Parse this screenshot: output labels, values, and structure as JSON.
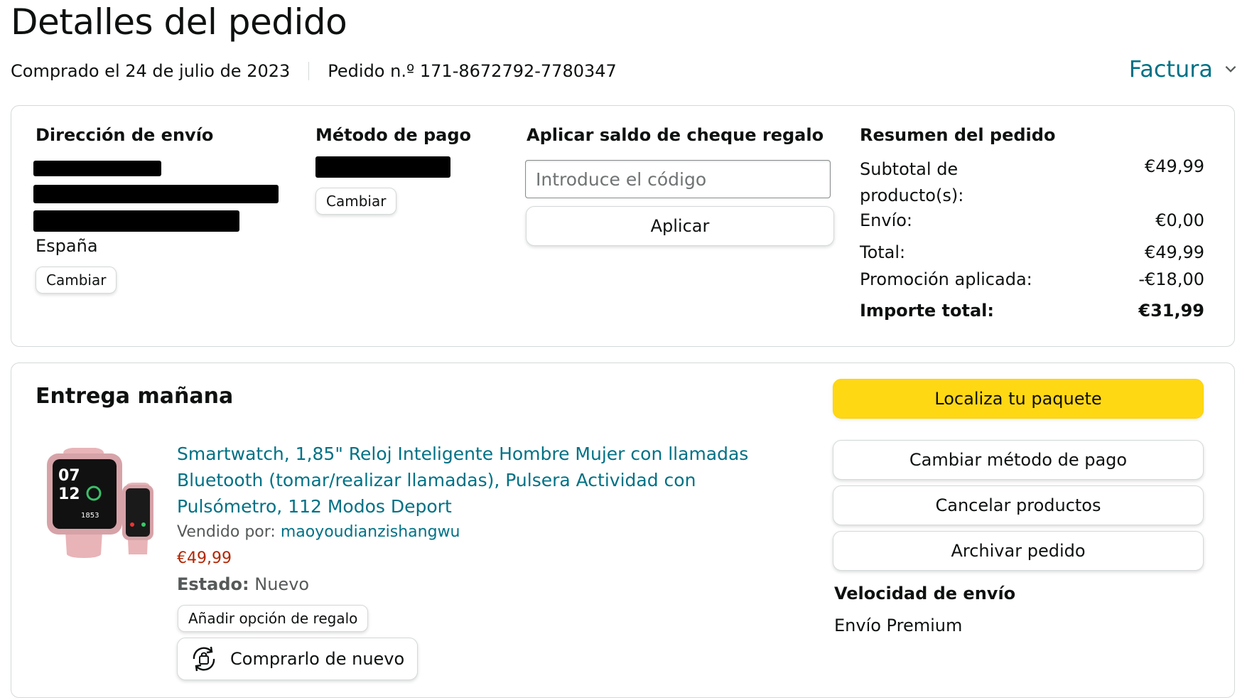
{
  "page_title": "Detalles del pedido",
  "order_meta": {
    "purchase_date": "Comprado el 24 de julio de 2023",
    "order_number": "Pedido n.º 171-8672792-7780347",
    "invoice_label": "Factura"
  },
  "shipping": {
    "heading": "Dirección de envío",
    "country": "España",
    "change_label": "Cambiar"
  },
  "payment": {
    "heading": "Método de pago",
    "change_label": "Cambiar"
  },
  "gift_card": {
    "heading": "Aplicar saldo de cheque regalo",
    "placeholder": "Introduce el código",
    "apply_label": "Aplicar"
  },
  "summary": {
    "heading": "Resumen del pedido",
    "rows": [
      {
        "label": "Subtotal de producto(s):",
        "value": "€49,99"
      },
      {
        "label": "Envío:",
        "value": "€0,00"
      },
      {
        "label": "Total:",
        "value": "€49,99"
      },
      {
        "label": "Promoción aplicada:",
        "value": "-€18,00"
      },
      {
        "label": "Importe total:",
        "value": "€31,99"
      }
    ]
  },
  "delivery": {
    "heading": "Entrega mañana",
    "product_title": "Smartwatch, 1,85\" Reloj Inteligente Hombre Mujer con llamadas Bluetooth (tomar/realizar llamadas), Pulsera Actividad con Pulsómetro, 112 Modos Deport",
    "sold_by_label": "Vendido por:",
    "seller": "maoyoudianzishangwu",
    "price": "€49,99",
    "condition_label": "Estado:",
    "condition_value": "Nuevo",
    "gift_option_label": "Añadir opción de regalo",
    "buy_again_label": "Comprarlo de nuevo",
    "actions": {
      "track": "Localiza tu paquete",
      "change_payment": "Cambiar método de pago",
      "cancel": "Cancelar productos",
      "archive": "Archivar pedido"
    },
    "shipping_speed_heading": "Velocidad de envío",
    "shipping_speed_value": "Envío Premium"
  },
  "colors": {
    "link": "#007185",
    "price": "#b12704",
    "primary_button": "#ffd814",
    "border": "#d5d9d9"
  }
}
